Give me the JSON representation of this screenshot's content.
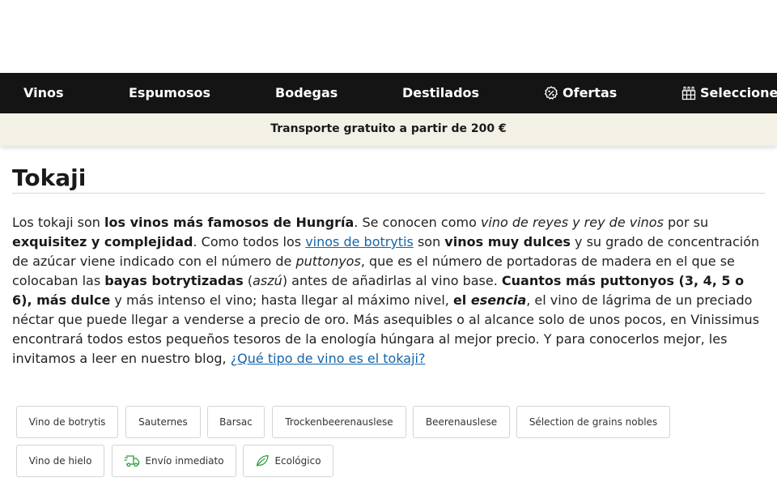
{
  "nav": {
    "items": [
      {
        "label": "Vinos"
      },
      {
        "label": "Espumosos"
      },
      {
        "label": "Bodegas"
      },
      {
        "label": "Destilados"
      },
      {
        "label": "Ofertas",
        "icon": "percent-badge-icon"
      },
      {
        "label": "Seleccione",
        "icon": "wine-crate-icon"
      }
    ]
  },
  "promo": {
    "text": "Transporte gratuito a partir de 200 €"
  },
  "page": {
    "title": "Tokaji"
  },
  "description": {
    "p1": "Los tokaji son ",
    "b1": "los vinos más famosos de Hungría",
    "p2": ". Se conocen como ",
    "i1": "vino de reyes y rey de vinos",
    "p3": " por su ",
    "b2": "exquisitez y complejidad",
    "p4": ". Como todos los ",
    "link1": "vinos de botrytis",
    "p5": " son ",
    "b3": "vinos muy dulces",
    "p6": " y su grado de concentración de azúcar viene indicado con el número de ",
    "i2": "puttonyos",
    "p7": ", que es el número de portadoras de madera en el que se colocaban las ",
    "b4": "bayas botrytizadas",
    "p8": " (",
    "i3": "aszú",
    "p9": ") antes de añadirlas al vino base. ",
    "b5": "Cuantos más puttonyos (3, 4, 5 o 6), más dulce",
    "p10": " y más intenso el vino; hasta llegar al máximo nivel, ",
    "b6": "el ",
    "bi1": "esencia",
    "p11": ", el vino de lágrima de un preciado néctar que puede llegar a venderse a precio de oro. Más asequibles o al alcance solo de unos pocos, en Vinissimus encontrará todos estos pequeños tesoros de la enología húngara al mejor precio. Y para conocerlos mejor, les invitamos a leer en nuestro blog, ",
    "link2": "¿Qué tipo de vino es el tokaji?"
  },
  "filters": [
    {
      "label": "Vino de botrytis"
    },
    {
      "label": "Sauternes"
    },
    {
      "label": "Barsac"
    },
    {
      "label": "Trockenbeerenauslese"
    },
    {
      "label": "Beerenauslese"
    },
    {
      "label": "Sélection de grains nobles"
    },
    {
      "label": "Vino de hielo"
    },
    {
      "label": "Envío inmediato",
      "icon": "delivery-truck-icon"
    },
    {
      "label": "Ecológico",
      "icon": "leaf-icon"
    }
  ],
  "colors": {
    "nav_bg": "#141414",
    "promo_bg": "#f3f1e6",
    "link": "#1565a8",
    "eco_green": "#2e9a3e"
  }
}
